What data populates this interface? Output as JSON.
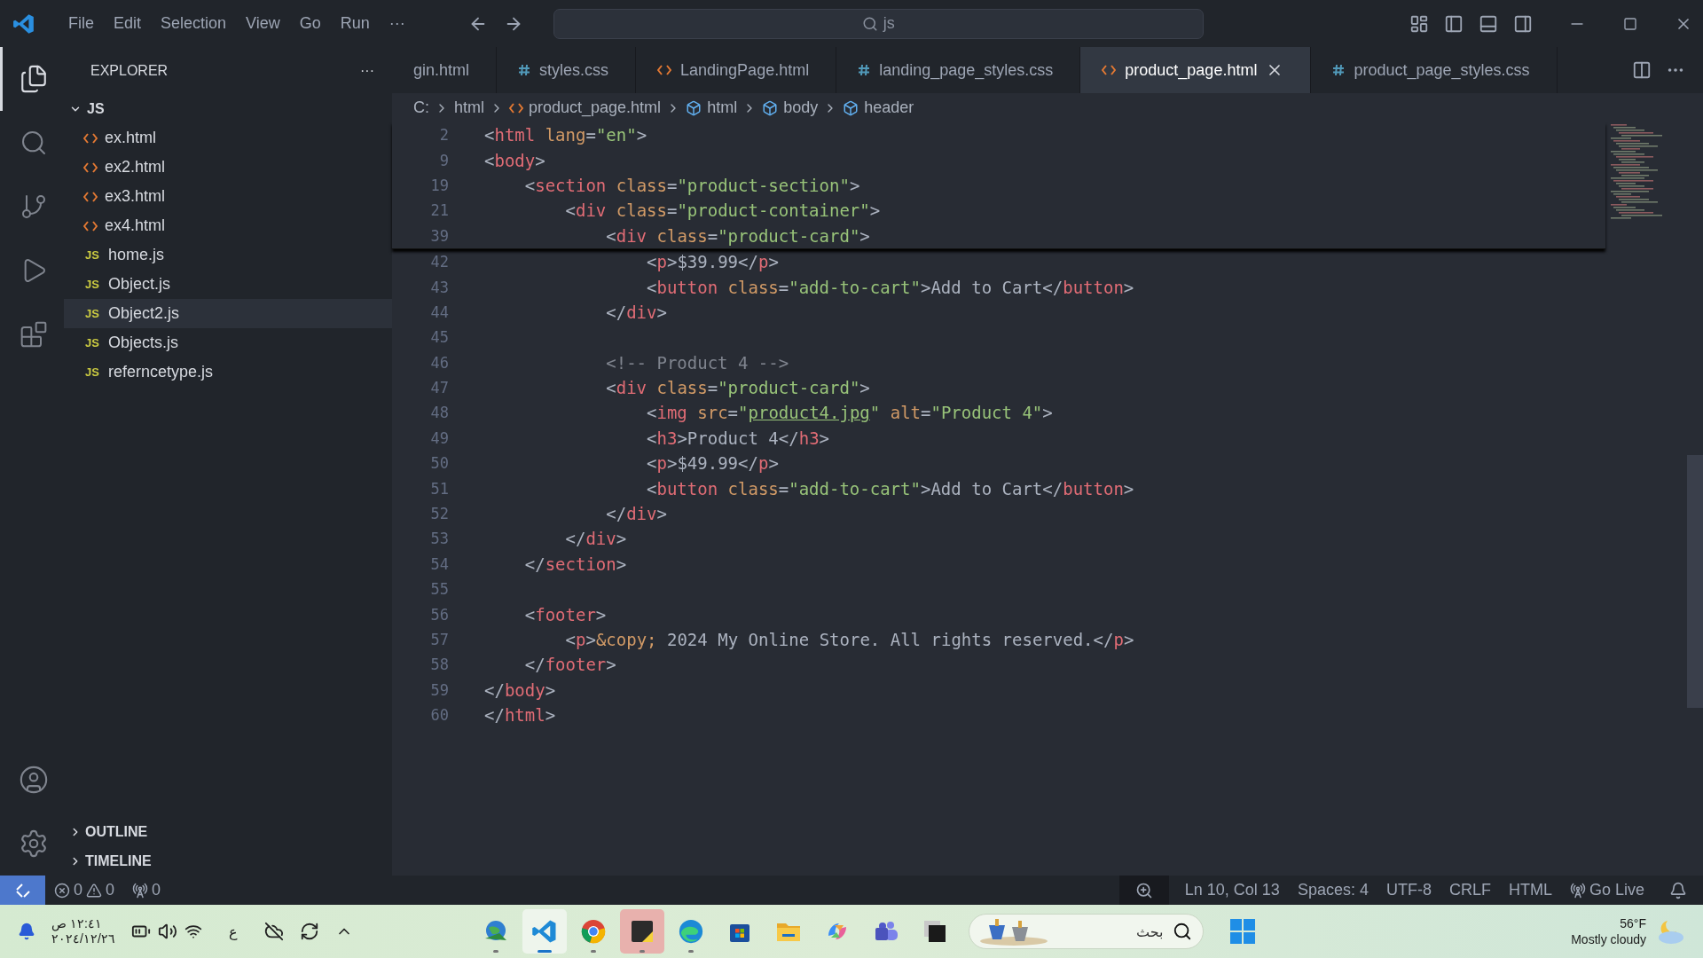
{
  "menu": [
    "File",
    "Edit",
    "Selection",
    "View",
    "Go",
    "Run",
    "···"
  ],
  "command_center": {
    "value": "js"
  },
  "sidebar": {
    "title": "EXPLORER",
    "more": "···",
    "folder": {
      "label": "JS",
      "expanded": true,
      "files": [
        {
          "name": "ex.html",
          "kind": "html",
          "selected": false
        },
        {
          "name": "ex2.html",
          "kind": "html",
          "selected": false
        },
        {
          "name": "ex3.html",
          "kind": "html",
          "selected": false
        },
        {
          "name": "ex4.html",
          "kind": "html",
          "selected": false
        },
        {
          "name": "home.js",
          "kind": "js",
          "badge": "JS",
          "selected": false
        },
        {
          "name": "Object.js",
          "kind": "js",
          "badge": "JS",
          "selected": false
        },
        {
          "name": "Object2.js",
          "kind": "js",
          "badge": "JS",
          "selected": true
        },
        {
          "name": "Objects.js",
          "kind": "js",
          "badge": "JS",
          "selected": false
        },
        {
          "name": "referncetype.js",
          "kind": "js",
          "badge": "JS",
          "selected": false
        }
      ]
    },
    "sections": [
      {
        "label": "OUTLINE",
        "expanded": false
      },
      {
        "label": "TIMELINE",
        "expanded": false
      }
    ]
  },
  "tabs": [
    {
      "label": "gin.html",
      "kind": "plain",
      "selected": false
    },
    {
      "label": "styles.css",
      "kind": "css",
      "selected": false
    },
    {
      "label": "LandingPage.html",
      "kind": "html",
      "selected": false
    },
    {
      "label": "landing_page_styles.css",
      "kind": "css",
      "selected": false
    },
    {
      "label": "product_page.html",
      "kind": "html",
      "selected": true
    },
    {
      "label": "product_page_styles.css",
      "kind": "css",
      "selected": false
    }
  ],
  "breadcrumb": [
    {
      "label": "C:",
      "kind": "folder"
    },
    {
      "label": "html",
      "kind": "folder"
    },
    {
      "label": "product_page.html",
      "kind": "file"
    },
    {
      "label": "html",
      "kind": "element"
    },
    {
      "label": "body",
      "kind": "element"
    },
    {
      "label": "header",
      "kind": "element"
    }
  ],
  "sticky_scroll": [
    {
      "n": "2",
      "text": "<html lang=\"en\">"
    },
    {
      "n": "9",
      "text": "<body>"
    },
    {
      "n": "19",
      "text": "    <section class=\"product-section\">"
    },
    {
      "n": "21",
      "text": "        <div class=\"product-container\">"
    },
    {
      "n": "39",
      "text": "            <div class=\"product-card\">"
    }
  ],
  "code": [
    {
      "n": "42",
      "text": "                <p>$39.99</p>"
    },
    {
      "n": "43",
      "text": "                <button class=\"add-to-cart\">Add to Cart</button>"
    },
    {
      "n": "44",
      "text": "            </div>"
    },
    {
      "n": "45"
    },
    {
      "n": "46",
      "text": "            <!-- Product 4 -->"
    },
    {
      "n": "47",
      "text": "            <div class=\"product-card\">"
    },
    {
      "n": "48",
      "text": "                <img src=\"product4.jpg\" alt=\"Product 4\">"
    },
    {
      "n": "49",
      "text": "                <h3>Product 4</h3>"
    },
    {
      "n": "50",
      "text": "                <p>$49.99</p>"
    },
    {
      "n": "51",
      "text": "                <button class=\"add-to-cart\">Add to Cart</button>"
    },
    {
      "n": "52",
      "text": "            </div>"
    },
    {
      "n": "53",
      "text": "        </div>"
    },
    {
      "n": "54",
      "text": "    </section>"
    },
    {
      "n": "55"
    },
    {
      "n": "56",
      "text": "    <footer>"
    },
    {
      "n": "57",
      "text": "        <p>&copy; 2024 My Online Store. All rights reserved.</p>"
    },
    {
      "n": "58",
      "text": "    </footer>"
    },
    {
      "n": "59",
      "text": "</body>"
    },
    {
      "n": "60",
      "text": "</html>"
    }
  ],
  "status_bar": {
    "errors": "0",
    "warnings": "0",
    "ports": "0",
    "position": "Ln 10, Col 13",
    "spaces": "Spaces: 4",
    "encoding": "UTF-8",
    "eol": "CRLF",
    "language": "HTML",
    "live": "Go Live"
  },
  "taskbar": {
    "time": "١٢:٤١ ص",
    "date": "٢٠٢٤/١٢/٢٦",
    "input_language": "ع",
    "apps": [
      {
        "kind": "globe",
        "running": true,
        "selected": false
      },
      {
        "kind": "vscode",
        "running": true,
        "selected": true
      },
      {
        "kind": "chrome",
        "running": true,
        "selected": false
      },
      {
        "kind": "notes",
        "running": true,
        "selected": false,
        "flagged": true
      },
      {
        "kind": "edge",
        "running": true,
        "selected": false
      },
      {
        "kind": "store",
        "running": false,
        "selected": false
      },
      {
        "kind": "files",
        "running": false,
        "selected": false
      },
      {
        "kind": "copilot",
        "running": false,
        "selected": false
      },
      {
        "kind": "teams",
        "running": false,
        "selected": false
      },
      {
        "kind": "terminal",
        "running": false,
        "selected": false
      }
    ],
    "search": {
      "placeholder": "بحث"
    },
    "weather": {
      "temperature": "56°F",
      "condition": "Mostly cloudy"
    }
  }
}
